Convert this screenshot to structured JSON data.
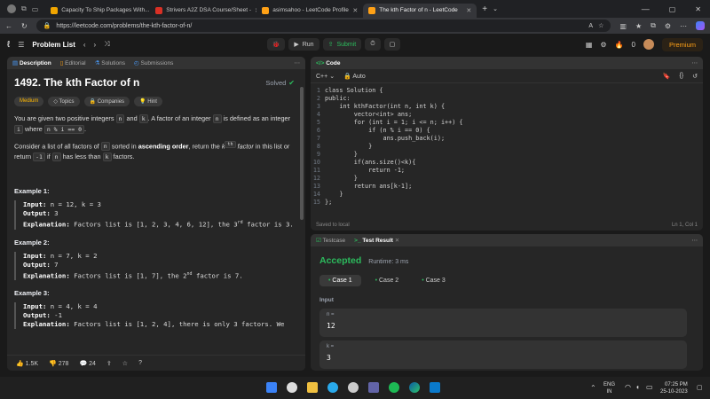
{
  "browser": {
    "tabs": [
      {
        "title": "Capacity To Ship Packages With...",
        "color": "#f0a500"
      },
      {
        "title": "Strivers A2Z DSA Course/Sheet -",
        "color": "#d93025"
      },
      {
        "title": "asimsahoo - LeetCode Profile",
        "color": "#ffa116"
      },
      {
        "title": "The kth Factor of n - LeetCode",
        "color": "#ffa116"
      }
    ],
    "url": "https://leetcode.com/problems/the-kth-factor-of-n/"
  },
  "lc_nav": {
    "problem_list": "Problem List",
    "run": "Run",
    "submit": "Submit",
    "streak": "0",
    "premium": "Premium"
  },
  "desc": {
    "tabs": [
      "Description",
      "Editorial",
      "Solutions",
      "Submissions"
    ],
    "title": "1492. The kth Factor of n",
    "solved": "Solved",
    "difficulty": "Medium",
    "chips": [
      "Topics",
      "Companies",
      "Hint"
    ],
    "p1": {
      "a": "You are given two positive integers ",
      "n": "n",
      "b": " and ",
      "k": "k",
      "c": ". A factor of an integer ",
      "n2": "n",
      "d": " is defined as an integer ",
      "i": "i",
      "e": " where ",
      "code": "n % i == 0",
      "f": "."
    },
    "p2": {
      "a": "Consider a list of all factors of ",
      "n": "n",
      "b": " sorted in ",
      "bold": "ascending order",
      "c": ", return the ",
      "kth": "k",
      "sup": "th",
      "it": " factor",
      "d": " in this list or return ",
      "m1": "-1",
      "e": " if ",
      "n2": "n",
      "f": " has less than ",
      "k2": "k",
      "g": " factors."
    },
    "examples": [
      {
        "title": "Example 1:",
        "input": "n = 12, k = 3",
        "output": "3",
        "expl_a": "Factors list is [1, 2, 3, 4, 6, 12], the 3",
        "sup": "rd",
        "expl_b": " factor is 3."
      },
      {
        "title": "Example 2:",
        "input": "n = 7, k = 2",
        "output": "7",
        "expl_a": "Factors list is [1, 7], the 2",
        "sup": "nd",
        "expl_b": " factor is 7."
      },
      {
        "title": "Example 3:",
        "input": "n = 4, k = 4",
        "output": "-1",
        "expl_a": "Factors list is [1, 2, 4], there is only 3 factors. We",
        "sup": "",
        "expl_b": ""
      }
    ],
    "labels": {
      "input": "Input:",
      "output": "Output:",
      "explanation": "Explanation:"
    },
    "footer": {
      "likes": "1.5K",
      "dislikes": "278",
      "comments": "24"
    }
  },
  "code": {
    "header": "Code",
    "lang": "C++",
    "auto": "Auto",
    "saved": "Saved to local",
    "cursor": "Ln 1, Col 1",
    "lines": [
      "class Solution {",
      "public:",
      "    int kthFactor(int n, int k) {",
      "        vector<int> ans;",
      "        for (int i = 1; i <= n; i++) {",
      "            if (n % i == 0) {",
      "                ans.push_back(i);",
      "            }",
      "        }",
      "        if(ans.size()<k){",
      "            return -1;",
      "        }",
      "        return ans[k-1];",
      "    }",
      "};"
    ]
  },
  "result": {
    "tabs": [
      "Testcase",
      "Test Result"
    ],
    "status": "Accepted",
    "runtime": "Runtime: 3 ms",
    "cases": [
      "Case 1",
      "Case 2",
      "Case 3"
    ],
    "input_label": "Input",
    "inputs": [
      {
        "name": "n =",
        "value": "12"
      },
      {
        "name": "k =",
        "value": "3"
      }
    ]
  },
  "taskbar": {
    "lang": "ENG",
    "region": "IN",
    "time": "07:25 PM",
    "date": "25-10-2023"
  }
}
